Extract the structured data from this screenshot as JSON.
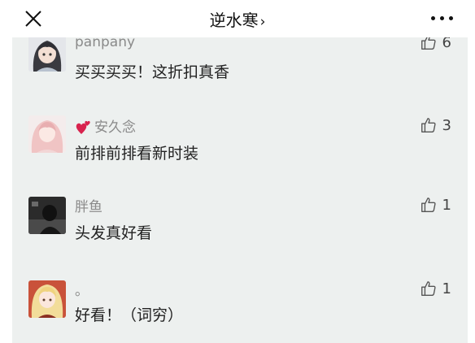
{
  "header": {
    "title": "逆水寒",
    "chevron": "›"
  },
  "comments": [
    {
      "nickname": "panpany",
      "text": "买买买买！这折扣真香",
      "likes": "6",
      "avatar": "anime-girl-dark-hair-avatar",
      "badge": ""
    },
    {
      "nickname": "安久念",
      "text": "前排前排看新时装",
      "likes": "3",
      "avatar": "pink-hair-girl-avatar",
      "badge": "red-hearts-icon"
    },
    {
      "nickname": "胖鱼",
      "text": "头发真好看",
      "likes": "1",
      "avatar": "dark-photo-avatar",
      "badge": ""
    },
    {
      "nickname": "。",
      "text": "好看！（词穷）",
      "likes": "1",
      "avatar": "blonde-anime-girl-avatar",
      "badge": ""
    }
  ],
  "colors": {
    "panel_background": "#edf0ef",
    "nickname": "#8a8a8a",
    "text": "#222222",
    "heart": "#d8234e"
  }
}
